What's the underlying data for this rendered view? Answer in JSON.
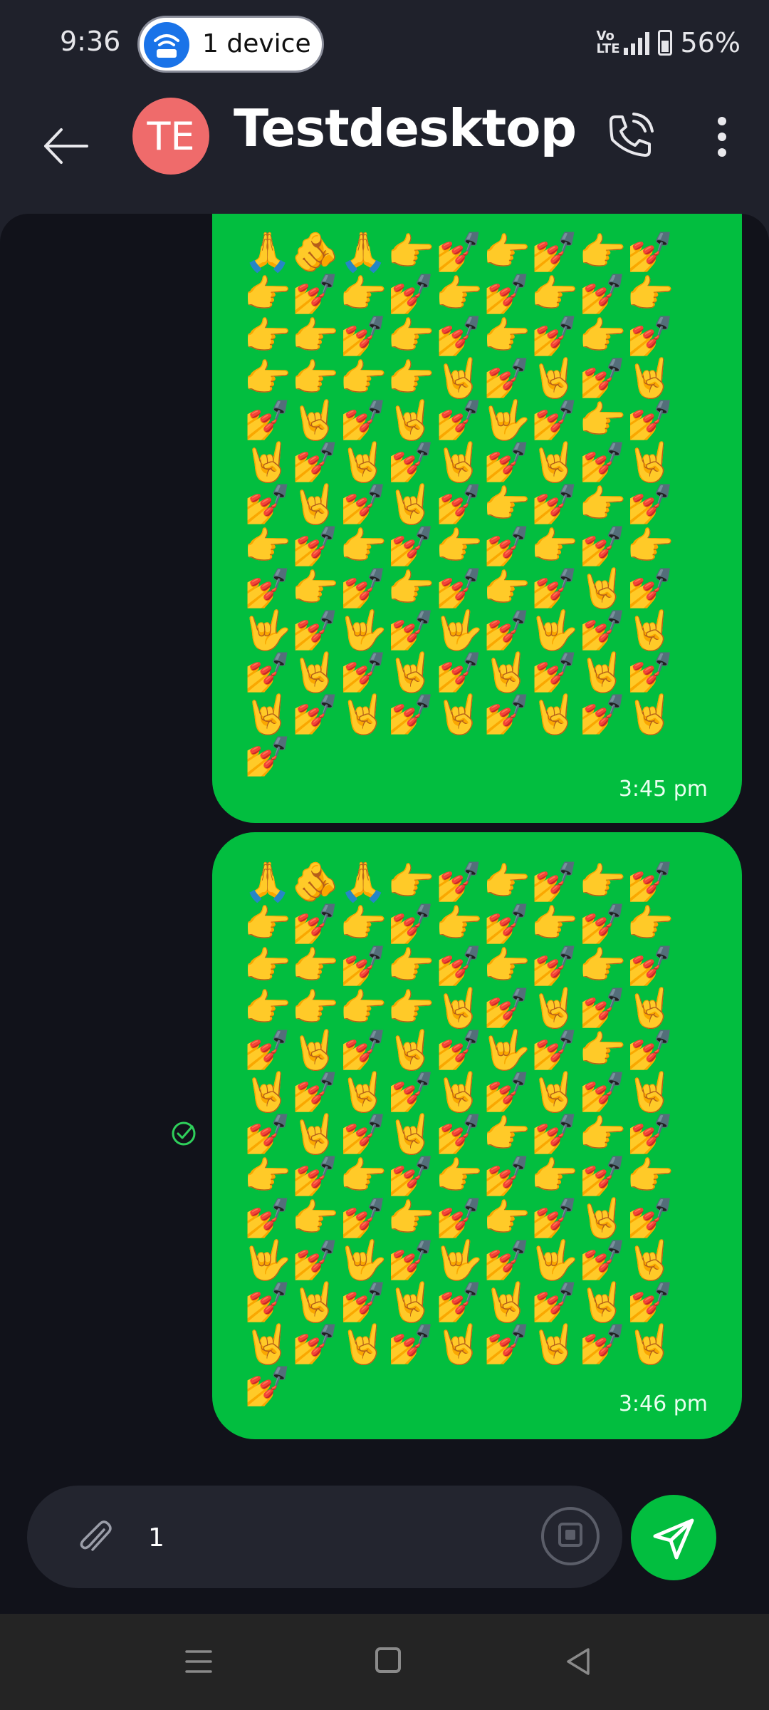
{
  "status_bar": {
    "time": "9:36",
    "hotspot_label": "1 device",
    "battery_percent": "56%"
  },
  "header": {
    "avatar_initials": "TE",
    "title": "Testdesktop"
  },
  "messages": [
    {
      "text": "🙏🫵🙏👉💅👉💅👉💅👉💅👉💅👉💅👉💅👉👉👉💅👉💅👉💅👉💅👉👉👉👉🤘💅🤘💅🤘💅🤘💅🤘💅🤟💅👉💅🤘💅🤘💅🤘💅🤘💅🤘💅🤘💅🤘💅👉💅👉💅👉💅👉💅👉💅👉💅👉💅👉💅👉💅👉💅🤘💅🤟💅🤟💅🤟💅🤟💅🤘💅🤘💅🤘💅🤘💅🤘💅🤘💅🤘💅🤘💅🤘💅🤘💅",
      "time": "3:45 pm"
    },
    {
      "text": "🙏🫵🙏👉💅👉💅👉💅👉💅👉💅👉💅👉💅👉👉👉💅👉💅👉💅👉💅👉👉👉👉🤘💅🤘💅🤘💅🤘💅🤘💅🤟💅👉💅🤘💅🤘💅🤘💅🤘💅🤘💅🤘💅🤘💅👉💅👉💅👉💅👉💅👉💅👉💅👉💅👉💅👉💅👉💅🤘💅🤟💅🤟💅🤟💅🤟💅🤘💅🤘💅🤘💅🤘💅🤘💅🤘💅🤘💅🤘💅🤘💅🤘💅",
      "time": "3:46 pm"
    }
  ],
  "composer": {
    "input_value": "1"
  },
  "colors": {
    "accent": "#02be3f",
    "avatar_bg": "#ef6b6b",
    "chat_bg": "#11121a",
    "header_bg": "#1f212b"
  },
  "icons": {
    "back": "arrow-left-icon",
    "call": "phone-icon",
    "more": "more-vertical-icon",
    "attach": "paperclip-icon",
    "sticker": "sticker-icon",
    "send": "send-icon",
    "read": "check-circle-icon"
  }
}
